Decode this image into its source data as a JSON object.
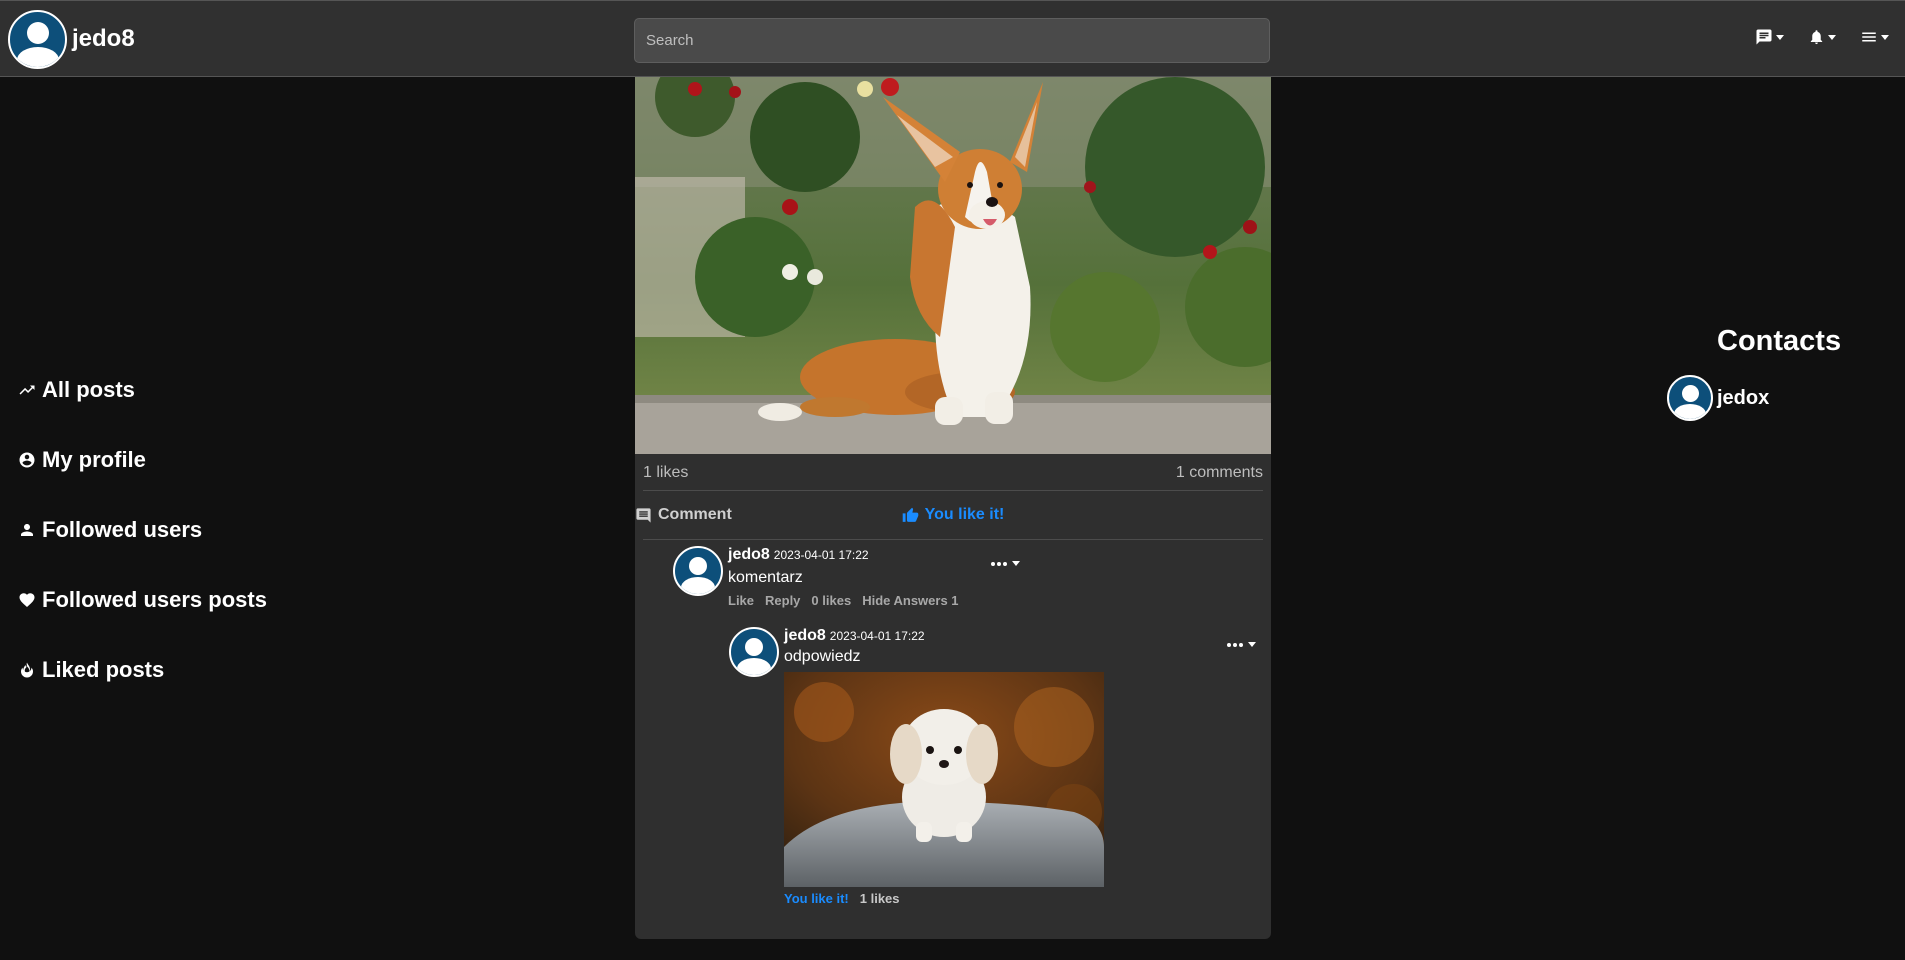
{
  "header": {
    "username": "jedo8",
    "search_placeholder": "Search",
    "icons": [
      "message-icon",
      "bell-icon",
      "menu-icon"
    ]
  },
  "sidebar": {
    "items": [
      {
        "label": "All posts",
        "icon": "trending-icon"
      },
      {
        "label": "My profile",
        "icon": "account-circle-icon"
      },
      {
        "label": "Followed users",
        "icon": "person-icon"
      },
      {
        "label": "Followed users posts",
        "icon": "heart-icon"
      },
      {
        "label": "Liked posts",
        "icon": "fire-icon"
      }
    ]
  },
  "post": {
    "image_alt": "corgi photo",
    "likes": "1 likes",
    "comments": "1 comments",
    "like_button": "You like it!",
    "comment_button": "Comment",
    "comment": {
      "username": "jedo8",
      "time": "2023-04-01 17:22",
      "text": "komentarz",
      "actions": {
        "like": "Like",
        "reply": "Reply",
        "likes": "0 likes",
        "hide_answers": "Hide Answers 1"
      },
      "reply": {
        "username": "jedo8",
        "time": "2023-04-01 17:22",
        "text": "odpowiedz",
        "image_alt": "white puppy photo",
        "liked_label": "You like it!",
        "likes": "1 likes"
      }
    }
  },
  "contacts": {
    "title": "Contacts",
    "items": [
      {
        "name": "jedox"
      }
    ]
  },
  "colors": {
    "accent": "#1a8cff",
    "avatar": "#0d4f7a",
    "topbar": "#303030",
    "background": "#101010",
    "card": "#2f2f2f"
  }
}
